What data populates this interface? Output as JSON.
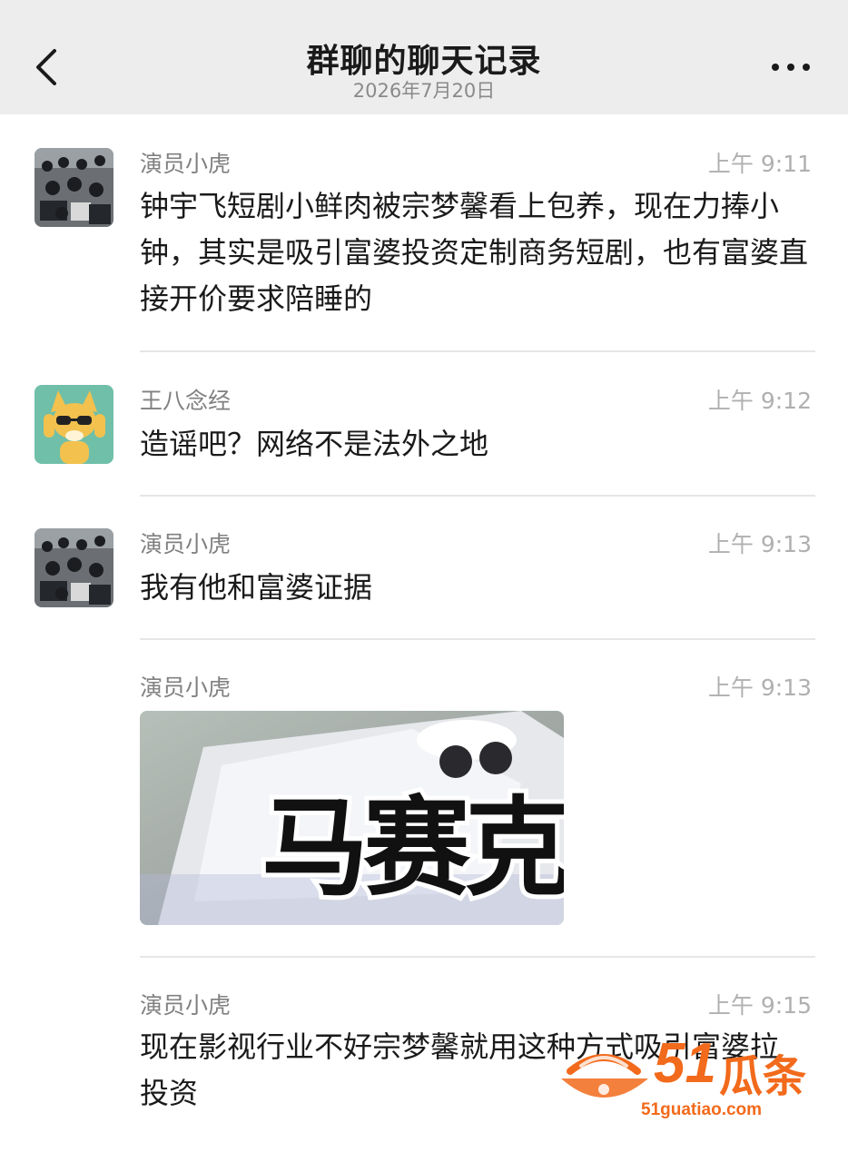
{
  "header": {
    "title": "群聊的聊天记录",
    "date": "2026年7月20日"
  },
  "messages": [
    {
      "sender": "演员小虎",
      "time": "上午 9:11",
      "text": "钟宇飞短剧小鲜肉被宗梦馨看上包养，现在力捧小钟，其实是吸引富婆投资定制商务短剧，也有富婆直接开价要求陪睡的"
    },
    {
      "sender": "王八念经",
      "time": "上午 9:12",
      "text": "造谣吧？网络不是法外之地"
    },
    {
      "sender": "演员小虎",
      "time": "上午 9:13",
      "text": "我有他和富婆证据"
    },
    {
      "sender": "演员小虎",
      "time": "上午 9:13",
      "image_overlay_text": "马赛克"
    },
    {
      "sender": "演员小虎",
      "time": "上午 9:15",
      "text": "现在影视行业不好宗梦馨就用这种方式吸引富婆拉投资"
    }
  ],
  "watermark": {
    "number": "51",
    "brand": "瓜条",
    "url": "51guatiao.com"
  },
  "colors": {
    "header_bg": "#ededed",
    "sender": "#808080",
    "time": "#b0b0b0",
    "watermark": "#f26a1b"
  },
  "icons": {
    "back": "chevron-left-icon",
    "more": "more-dots-icon"
  }
}
